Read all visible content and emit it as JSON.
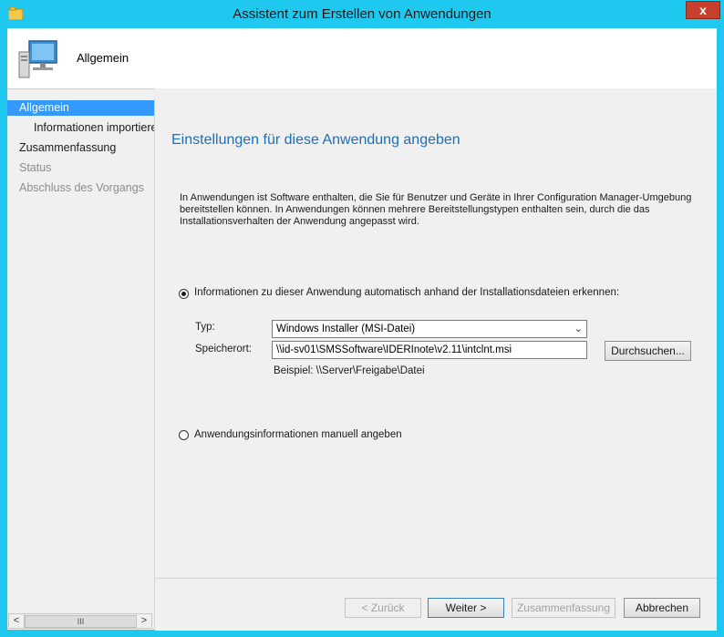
{
  "window": {
    "title": "Assistent zum Erstellen von Anwendungen",
    "close_label": "x"
  },
  "header": {
    "title": "Allgemein",
    "icon": "computer-icon"
  },
  "nav": {
    "items": [
      {
        "label": "Allgemein",
        "state": "selected"
      },
      {
        "label": "Informationen importieren",
        "state": "sub"
      },
      {
        "label": "Zusammenfassung",
        "state": "normal"
      },
      {
        "label": "Status",
        "state": "disabled"
      },
      {
        "label": "Abschluss des Vorgangs",
        "state": "disabled"
      }
    ],
    "scrollbar": {
      "left": "<",
      "right": ">",
      "thumb": "III"
    }
  },
  "main": {
    "title": "Einstellungen für diese Anwendung angeben",
    "description": "In Anwendungen ist Software enthalten, die Sie für Benutzer und Geräte in Ihrer Configuration Manager-Umgebung bereitstellen können. In Anwendungen können mehrere Bereitstellungstypen enthalten sein, durch die das Installationsverhalten der Anwendung angepasst wird.",
    "option_auto": {
      "label": "Informationen zu dieser Anwendung automatisch anhand der Installationsdateien erkennen:",
      "checked": true
    },
    "type_label": "Typ:",
    "type_value": "Windows Installer (MSI-Datei)",
    "location_label": "Speicherort:",
    "location_value": "\\\\id-sv01\\SMSSoftware\\IDERInote\\v2.11\\intclnt.msi",
    "browse_label": "Durchsuchen...",
    "example": "Beispiel: \\\\Server\\Freigabe\\Datei",
    "option_manual": {
      "label": "Anwendungsinformationen manuell angeben",
      "checked": false
    }
  },
  "footer": {
    "back": "< Zurück",
    "next": "Weiter >",
    "summary": "Zusammenfassung",
    "cancel": "Abbrechen"
  },
  "colors": {
    "frame": "#1ec8ef",
    "selection": "#3399ff",
    "title_blue": "#1e6fb7",
    "close_red": "#c7402e"
  }
}
